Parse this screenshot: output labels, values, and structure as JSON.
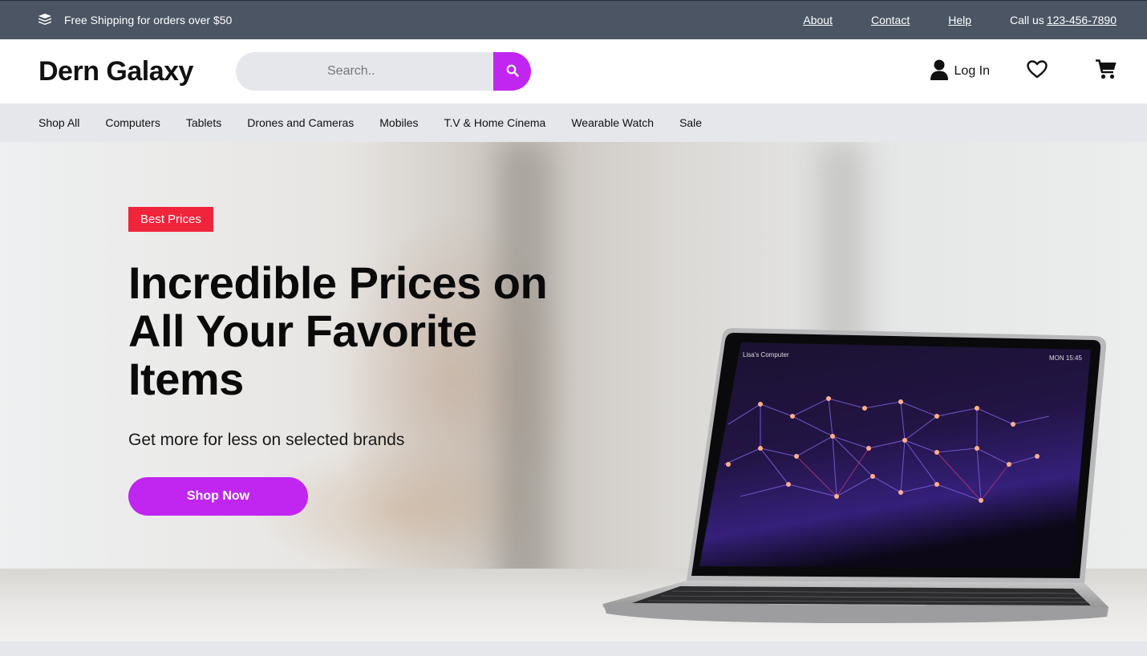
{
  "topbar": {
    "shipping_text": "Free Shipping for orders over $50",
    "links": {
      "about": "About",
      "contact": "Contact",
      "help": "Help"
    },
    "call_prefix": "Call us",
    "phone": "123-456-7890",
    "icon": "box-stack-icon"
  },
  "header": {
    "logo": "Dern Galaxy",
    "search": {
      "placeholder": "Search..",
      "value": "",
      "button_icon": "search-icon"
    },
    "login_label": "Log In",
    "icons": [
      "user-icon",
      "heart-icon",
      "cart-icon"
    ]
  },
  "categories": [
    "Shop All",
    "Computers",
    "Tablets",
    "Drones and Cameras",
    "Mobiles",
    "T.V & Home Cinema",
    "Wearable Watch",
    "Sale"
  ],
  "hero": {
    "badge": "Best Prices",
    "title": "Incredible Prices on All Your Favorite Items",
    "subtitle": "Get more for less on selected brands",
    "cta": "Shop Now",
    "laptop_screen": {
      "name": "Lisa's Computer",
      "status": "MON  15:45"
    }
  },
  "colors": {
    "accent": "#c026f0",
    "badge": "#f0243a",
    "topbar": "#4b5563",
    "nav": "#e5e7eb"
  }
}
